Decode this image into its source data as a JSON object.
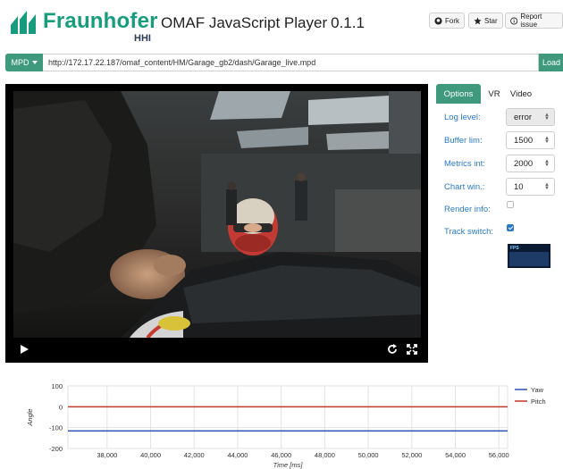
{
  "header": {
    "brand": "Fraunhofer",
    "brand_sub": "HHI",
    "app_title": "OMAF JavaScript Player",
    "version": "0.1.1",
    "fork_label": "Fork",
    "star_label": "Star",
    "report_label": "Report issue"
  },
  "urlbar": {
    "mpd_label": "MPD",
    "url": "http://172.17.22.187/omaf_content/HM/Garage_gb2/dash/Garage_live.mpd",
    "load_label": "Load"
  },
  "options": {
    "tabs": [
      "Options",
      "VR",
      "Video"
    ],
    "active_tab": "Options",
    "log_level_label": "Log level:",
    "log_level_value": "error",
    "buffer_lim_label": "Buffer lim:",
    "buffer_lim_value": "1500",
    "metrics_int_label": "Metrics int:",
    "metrics_int_value": "2000",
    "chart_win_label": "Chart win.:",
    "chart_win_value": "10",
    "render_info_label": "Render info:",
    "render_info_checked": false,
    "track_switch_label": "Track switch:",
    "track_switch_checked": true,
    "fps_label": "FPS"
  },
  "icons": {
    "play": "play-icon",
    "replay": "replay-icon",
    "fullscreen": "fullscreen-icon",
    "github": "github-icon",
    "star": "star-icon",
    "info": "info-icon",
    "caret": "caret-down-icon"
  },
  "colors": {
    "accent": "#3f9a7d",
    "brand": "#179c7d",
    "link": "#2a7ac9",
    "yaw": "#2c4fb0",
    "pitch": "#c0392b"
  },
  "chart_data": {
    "type": "line",
    "ylabel": "Angle",
    "xlabel": "Time [ms]",
    "xlim": [
      36200,
      56400
    ],
    "ylim": [
      -200,
      100
    ],
    "x_ticks": [
      "38,000",
      "40,000",
      "42,000",
      "44,000",
      "46,000",
      "48,000",
      "50,000",
      "52,000",
      "54,000",
      "56,000"
    ],
    "x_tick_values": [
      38000,
      40000,
      42000,
      44000,
      46000,
      48000,
      50000,
      52000,
      54000,
      56000
    ],
    "y_ticks": [
      "100",
      "0",
      "-100",
      "-200"
    ],
    "y_tick_values": [
      100,
      0,
      -100,
      -200
    ],
    "grid": true,
    "legend_position": "right",
    "series": [
      {
        "name": "Yaw",
        "color": "#2c4fb0",
        "x": [
          36200,
          56400
        ],
        "y": [
          -116,
          -116
        ]
      },
      {
        "name": "Pitch",
        "color": "#c0392b",
        "x": [
          36200,
          56400
        ],
        "y": [
          0,
          0
        ]
      }
    ]
  }
}
